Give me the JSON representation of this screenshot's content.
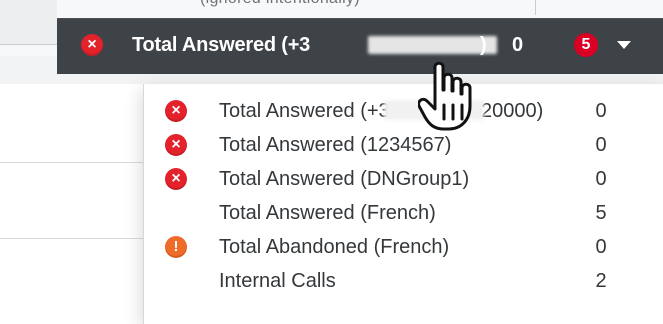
{
  "colors": {
    "kpi_bar": "#3e4347",
    "error": "#e3222c",
    "warning": "#ef6b28",
    "badge": "#d90023",
    "text": "#34383b",
    "white": "#ffffff"
  },
  "background": {
    "clipped_text": "(ignored intentionally)"
  },
  "kpi": {
    "label_prefix": "Total Answered (+3",
    "label_suffix": ")",
    "value": "0",
    "badge_count": "5",
    "status_icon": "error-icon",
    "expand_icon": "chevron-down-icon"
  },
  "dropdown": {
    "items": [
      {
        "icon": "error-icon",
        "label": "Total Answered (+3",
        "label_tail": "8020000)",
        "value": "0"
      },
      {
        "icon": "error-icon",
        "label": "Total Answered (1234567)",
        "value": "0"
      },
      {
        "icon": "error-icon",
        "label": "Total Answered (DNGroup1)",
        "value": "0"
      },
      {
        "icon": "",
        "label": "Total Answered (French)",
        "value": "5"
      },
      {
        "icon": "warning-icon",
        "label": "Total Abandoned (French)",
        "value": "0"
      },
      {
        "icon": "",
        "label": "Internal Calls",
        "value": "2"
      }
    ]
  },
  "cursor": "hand-cursor-icon"
}
